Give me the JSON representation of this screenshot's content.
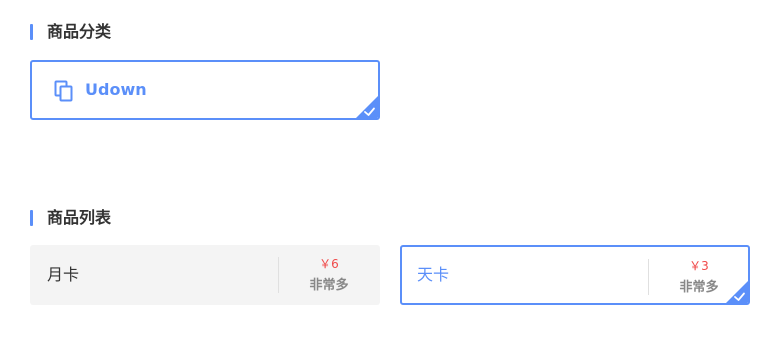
{
  "colors": {
    "accent": "#5b8ff9",
    "price": "#f04a4a",
    "muted": "#888888",
    "text": "#333333",
    "card_bg": "#f4f4f4"
  },
  "categories_section": {
    "title": "商品分类",
    "items": [
      {
        "label": "Udown",
        "icon": "copy-icon",
        "selected": true
      }
    ]
  },
  "products_section": {
    "title": "商品列表",
    "items": [
      {
        "name": "月卡",
        "price": "￥6",
        "stock": "非常多",
        "selected": false
      },
      {
        "name": "天卡",
        "price": "￥3",
        "stock": "非常多",
        "selected": true
      }
    ]
  }
}
